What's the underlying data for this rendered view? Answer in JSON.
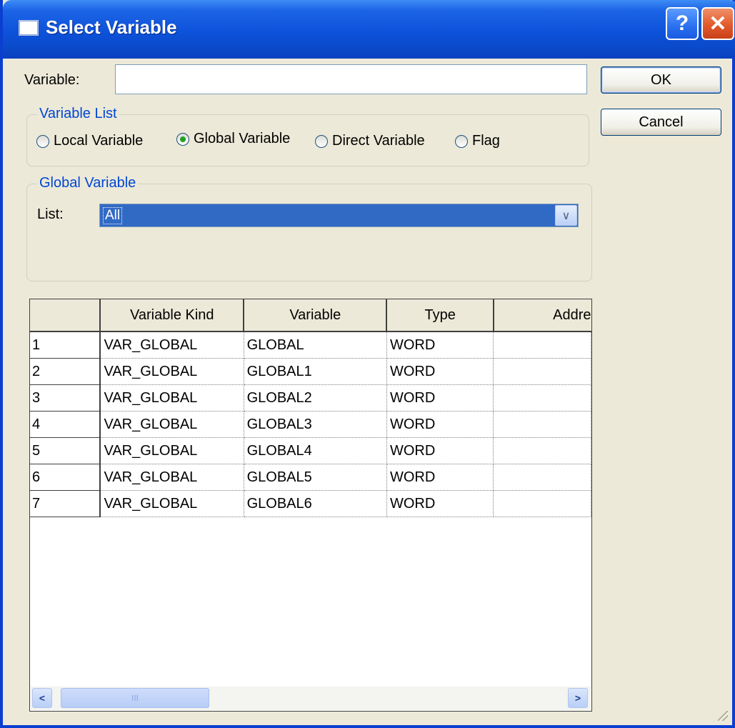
{
  "window": {
    "title": "Select Variable",
    "help": "?",
    "close": "✕"
  },
  "variable": {
    "label": "Variable:",
    "value": ""
  },
  "buttons": {
    "ok": "OK",
    "cancel": "Cancel"
  },
  "variable_list": {
    "title": "Variable List",
    "options": [
      {
        "label": "Local Variable",
        "selected": false
      },
      {
        "label": "Global Variable",
        "selected": true
      },
      {
        "label": "Direct Variable",
        "selected": false
      },
      {
        "label": "Flag",
        "selected": false
      }
    ]
  },
  "global_variable": {
    "title": "Global Variable",
    "list_label": "List:",
    "list_value": "All"
  },
  "table": {
    "columns": [
      "",
      "Variable Kind",
      "Variable",
      "Type",
      "Addre"
    ],
    "rows": [
      [
        "1",
        "VAR_GLOBAL",
        "GLOBAL",
        "WORD",
        ""
      ],
      [
        "2",
        "VAR_GLOBAL",
        "GLOBAL1",
        "WORD",
        ""
      ],
      [
        "3",
        "VAR_GLOBAL",
        "GLOBAL2",
        "WORD",
        ""
      ],
      [
        "4",
        "VAR_GLOBAL",
        "GLOBAL3",
        "WORD",
        ""
      ],
      [
        "5",
        "VAR_GLOBAL",
        "GLOBAL4",
        "WORD",
        ""
      ],
      [
        "6",
        "VAR_GLOBAL",
        "GLOBAL5",
        "WORD",
        ""
      ],
      [
        "7",
        "VAR_GLOBAL",
        "GLOBAL6",
        "WORD",
        ""
      ]
    ]
  },
  "scroll": {
    "left": "<",
    "right": ">",
    "thumb": "III"
  },
  "icons": {
    "window": "window-icon",
    "help": "help-icon",
    "close": "close-icon",
    "dropdown": "chevron-down-icon"
  }
}
